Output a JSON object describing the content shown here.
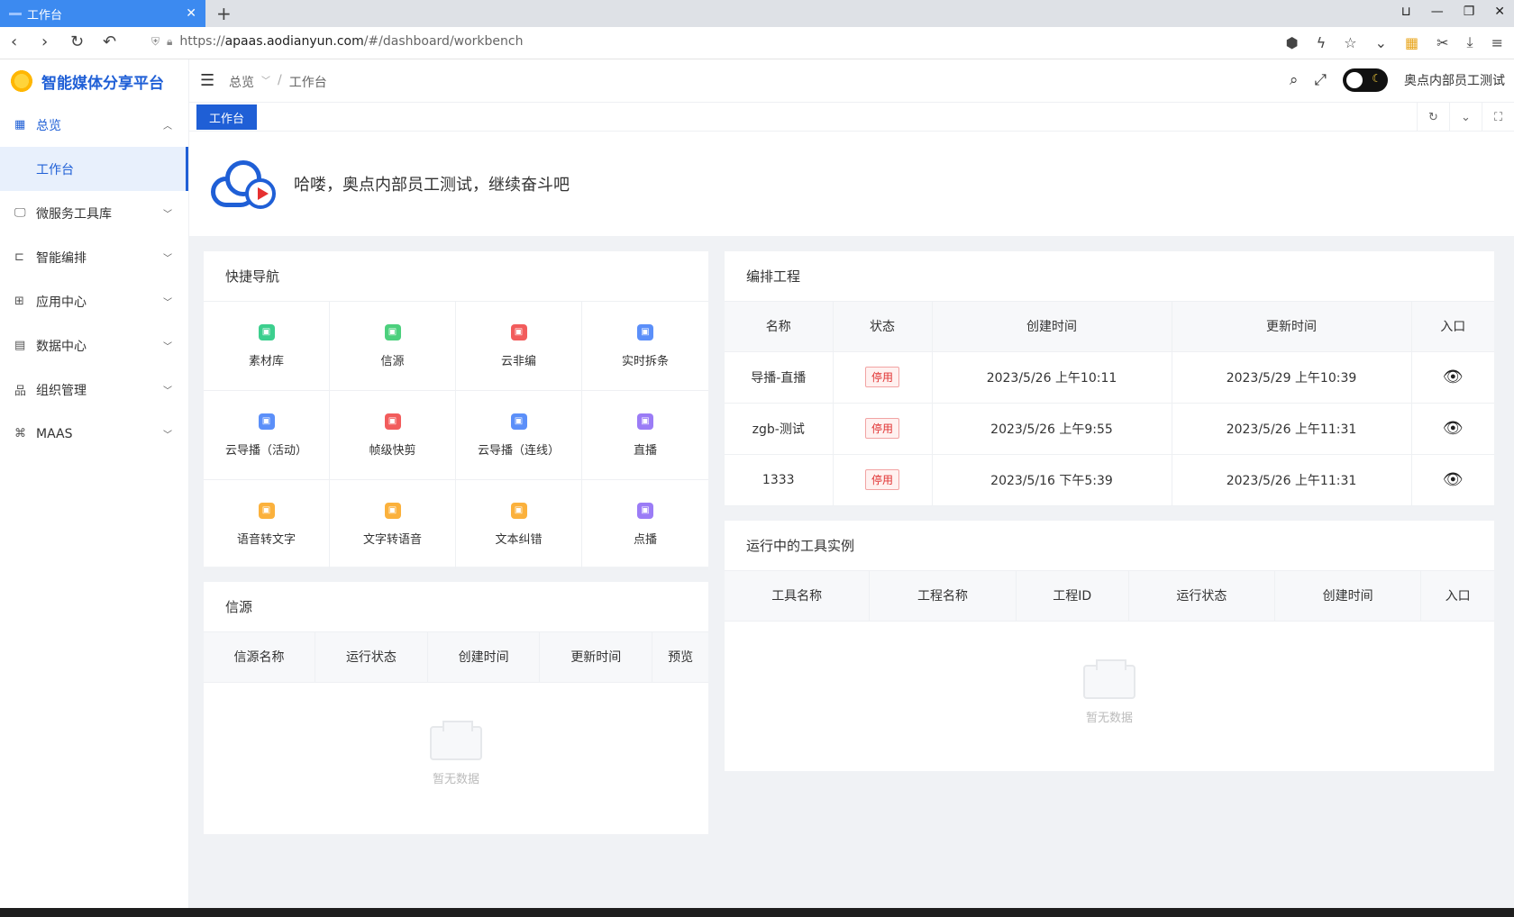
{
  "browser": {
    "tab_title": "工作台",
    "url_scheme": "https://",
    "url_host": "apaas.aodianyun.com",
    "url_path": "/#/dashboard/workbench"
  },
  "sidebar": {
    "logo_text": "智能媒体分享平台",
    "items": [
      {
        "label": "总览",
        "icon": "grid-icon",
        "open": true
      },
      {
        "label": "微服务工具库",
        "icon": "monitor-icon"
      },
      {
        "label": "智能编排",
        "icon": "flow-icon"
      },
      {
        "label": "应用中心",
        "icon": "apps-icon"
      },
      {
        "label": "数据中心",
        "icon": "database-icon"
      },
      {
        "label": "组织管理",
        "icon": "org-icon"
      },
      {
        "label": "MAAS",
        "icon": "command-icon"
      }
    ],
    "sub_item": "工作台"
  },
  "header": {
    "crumb_root": "总览",
    "crumb_current": "工作台",
    "username": "奥点内部员工测试"
  },
  "tags": {
    "active": "工作台"
  },
  "welcome": {
    "text": "哈喽，奥点内部员工测试，继续奋斗吧"
  },
  "quick_nav": {
    "title": "快捷导航",
    "items": [
      {
        "label": "素材库",
        "color": "#3ccf8e"
      },
      {
        "label": "信源",
        "color": "#4cd07d"
      },
      {
        "label": "云非编",
        "color": "#f25c5c"
      },
      {
        "label": "实时拆条",
        "color": "#5b8ff9"
      },
      {
        "label": "云导播（活动）",
        "color": "#5b8ff9"
      },
      {
        "label": "帧级快剪",
        "color": "#f25c5c"
      },
      {
        "label": "云导播（连线）",
        "color": "#5b8ff9"
      },
      {
        "label": "直播",
        "color": "#9b7cf6"
      },
      {
        "label": "语音转文字",
        "color": "#fbb13c"
      },
      {
        "label": "文字转语音",
        "color": "#fbb13c"
      },
      {
        "label": "文本纠错",
        "color": "#fbb13c"
      },
      {
        "label": "点播",
        "color": "#9b7cf6"
      }
    ]
  },
  "source": {
    "title": "信源",
    "columns": [
      "信源名称",
      "运行状态",
      "创建时间",
      "更新时间",
      "预览"
    ],
    "empty": "暂无数据"
  },
  "projects": {
    "title": "编排工程",
    "columns": [
      "名称",
      "状态",
      "创建时间",
      "更新时间",
      "入口"
    ],
    "rows": [
      {
        "name": "导播-直播",
        "status": "停用",
        "created": "2023/5/26 上午10:11",
        "updated": "2023/5/29 上午10:39"
      },
      {
        "name": "zgb-测试",
        "status": "停用",
        "created": "2023/5/26 上午9:55",
        "updated": "2023/5/26 上午11:31"
      },
      {
        "name": "1333",
        "status": "停用",
        "created": "2023/5/16 下午5:39",
        "updated": "2023/5/26 上午11:31"
      }
    ]
  },
  "tools": {
    "title": "运行中的工具实例",
    "columns": [
      "工具名称",
      "工程名称",
      "工程ID",
      "运行状态",
      "创建时间",
      "入口"
    ],
    "empty": "暂无数据"
  }
}
